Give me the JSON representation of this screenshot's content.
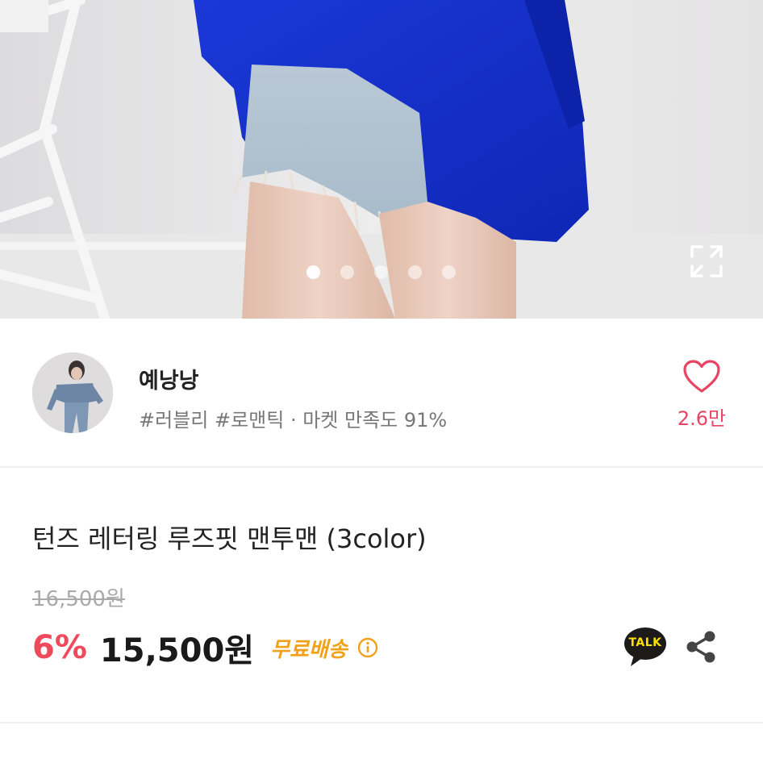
{
  "gallery": {
    "slide_count": 5,
    "active_index": 0,
    "expand_icon": "expand-icon"
  },
  "seller": {
    "name": "예낭낭",
    "tags": "#러블리 #로맨틱 · 마켓 만족도 91%",
    "likes": "2.6만",
    "like_icon": "heart-outline-icon"
  },
  "product": {
    "title": "턴즈 레터링 루즈핏 맨투맨 (3color)",
    "original_price": "16,500원",
    "discount": "6%",
    "sale_price": "15,500원",
    "shipping": "무료배송",
    "talk_label": "TALK",
    "share_icon": "share-icon"
  },
  "colors": {
    "accent": "#e84463",
    "discount": "#ef4a5c",
    "shipping": "#f0a21a",
    "talk_bg": "#fae100"
  }
}
